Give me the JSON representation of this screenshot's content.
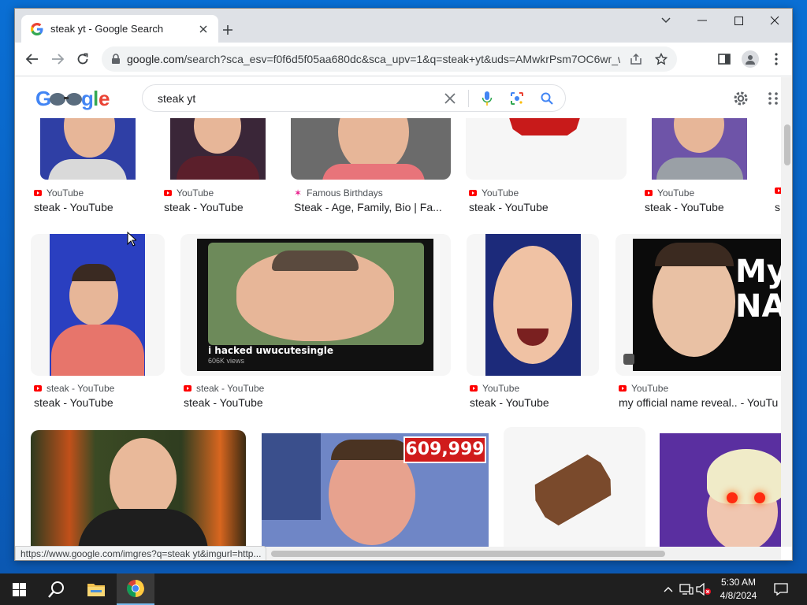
{
  "browser": {
    "tab_title": "steak yt - Google Search",
    "url_host": "google.com",
    "url_rest": "/search?sca_esv=f0f6d5f05aa680dc&sca_upv=1&q=steak+yt&uds=AMwkrPsm7OC6wr_wb2ps...",
    "status_url": "https://www.google.com/imgres?q=steak yt&imgurl=http..."
  },
  "google": {
    "logo_text": "Google",
    "query": "steak yt"
  },
  "results": {
    "row1": [
      {
        "source": "YouTube",
        "title": "steak - YouTube"
      },
      {
        "source": "YouTube",
        "title": "steak - YouTube"
      },
      {
        "source": "Famous Birthdays",
        "title": "Steak - Age, Family, Bio | Fa..."
      },
      {
        "source": "YouTube",
        "title": "steak - YouTube"
      },
      {
        "source": "YouTube",
        "title": "steak - YouTube"
      },
      {
        "source": "",
        "title": "s"
      }
    ],
    "row2": [
      {
        "source": "steak - YouTube",
        "title": "steak - YouTube"
      },
      {
        "source": "steak - YouTube",
        "title": "steak - YouTube",
        "overlay": "i hacked uwucutesingle",
        "overlay_sub": "606K views"
      },
      {
        "source": "YouTube",
        "title": "steak - YouTube"
      },
      {
        "source": "YouTube",
        "title": "my official name reveal.. - YouTu",
        "overlay": "My NA"
      }
    ],
    "row3": [
      {
        "badge": "609,999"
      }
    ]
  },
  "taskbar": {
    "time": "5:30 AM",
    "date": "4/8/2024"
  },
  "colors": {
    "google_blue": "#4285f4",
    "google_red": "#ea4335",
    "google_yellow": "#fbbc05",
    "google_green": "#34a853",
    "youtube_red": "#ff0000"
  }
}
